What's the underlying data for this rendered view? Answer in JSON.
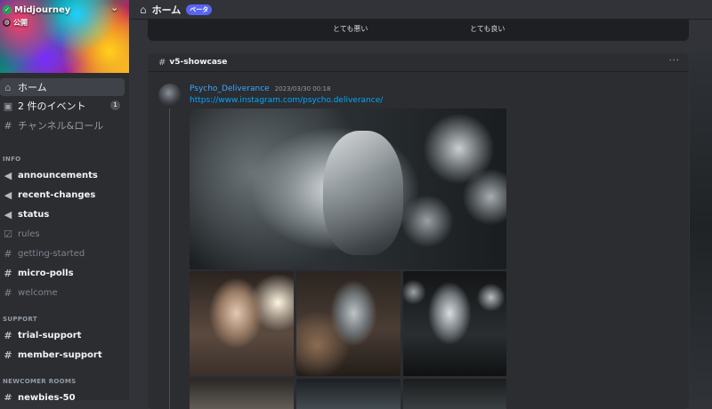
{
  "server": {
    "name": "Midjourney",
    "visibility": "公開",
    "verified_glyph": "✓",
    "chevron": "⌄"
  },
  "nav": {
    "home": {
      "icon": "⌂",
      "label": "ホーム"
    },
    "events": {
      "icon": "▣",
      "label": "2 件のイベント",
      "count": "1"
    },
    "channels_roles": {
      "icon": "#",
      "label": "チャンネル&ロール"
    }
  },
  "categories": {
    "info": "INFO",
    "support": "SUPPORT",
    "newcomer": "NEWCOMER ROOMS"
  },
  "channels": {
    "info": [
      {
        "icon": "📢",
        "name": "announcements",
        "state": "bright"
      },
      {
        "icon": "📢",
        "name": "recent-changes",
        "state": "bright"
      },
      {
        "icon": "📢",
        "name": "status",
        "state": "bright"
      },
      {
        "icon": "☑",
        "name": "rules",
        "state": "dim"
      },
      {
        "icon": "#",
        "name": "getting-started",
        "state": "dim"
      },
      {
        "icon": "#",
        "name": "micro-polls",
        "state": "bright"
      },
      {
        "icon": "#",
        "name": "welcome",
        "state": "dim"
      }
    ],
    "support": [
      {
        "icon": "#",
        "name": "trial-support",
        "state": "bright"
      },
      {
        "icon": "#",
        "name": "member-support",
        "state": "bright"
      }
    ],
    "newcomer": [
      {
        "icon": "#",
        "name": "newbies-50",
        "state": "bright"
      }
    ]
  },
  "topbar": {
    "icon": "⌂",
    "title": "ホーム",
    "badge": "ベータ"
  },
  "poll": {
    "left_label": "とても悪い",
    "right_label": "とても良い"
  },
  "post": {
    "channel_hash": "#",
    "channel": "v5-showcase",
    "more": "···",
    "author": "Psycho_Deliverance",
    "timestamp": "2023/03/30 00:18",
    "link": "https://www.instagram.com/psycho.deliverance/"
  },
  "colors": {
    "accent": "#5865f2",
    "link": "#00a8fc",
    "author": "#3ea6ff",
    "sidebar_bg": "#2b2d31",
    "main_bg": "#313338"
  }
}
